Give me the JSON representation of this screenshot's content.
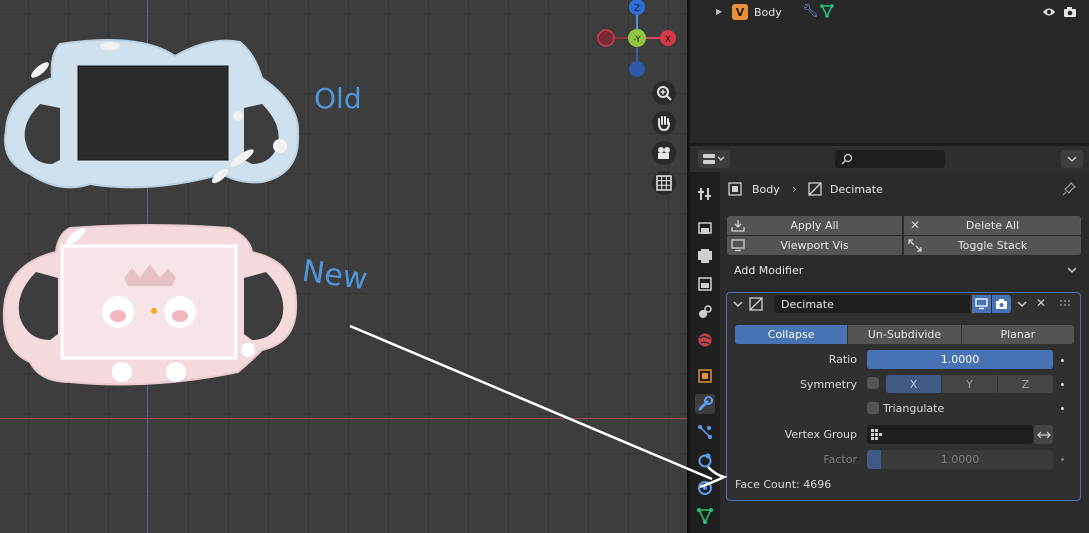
{
  "viewport": {
    "annotations": {
      "old": "Old",
      "new": "New"
    },
    "gizmo": {
      "z": "Z",
      "y": "-Y",
      "x": "X"
    },
    "icons": [
      "zoom-icon",
      "hand-icon",
      "camera-icon",
      "grid-icon"
    ]
  },
  "outliner": {
    "item_label": "Body"
  },
  "properties": {
    "breadcrumb": {
      "object": "Body",
      "modifier": "Decimate"
    },
    "ops": {
      "apply_all": "Apply All",
      "delete_all": "Delete All",
      "viewport_vis": "Viewport Vis",
      "toggle_stack": "Toggle Stack"
    },
    "add_modifier": "Add Modifier",
    "modifier": {
      "name": "Decimate",
      "modes": [
        "Collapse",
        "Un-Subdivide",
        "Planar"
      ],
      "active_mode": "Collapse",
      "ratio_label": "Ratio",
      "ratio_value": "1.0000",
      "ratio_fraction": 1.0,
      "symmetry_label": "Symmetry",
      "symmetry_axes": [
        "X",
        "Y",
        "Z"
      ],
      "triangulate_label": "Triangulate",
      "vertex_group_label": "Vertex Group",
      "factor_label": "Factor",
      "factor_value": "1.0000",
      "face_count": "Face Count: 4696"
    }
  },
  "colors": {
    "accent": "#4772b3",
    "header_bg": "#3d3d3d",
    "viewport_bg": "#3d3d3d"
  }
}
